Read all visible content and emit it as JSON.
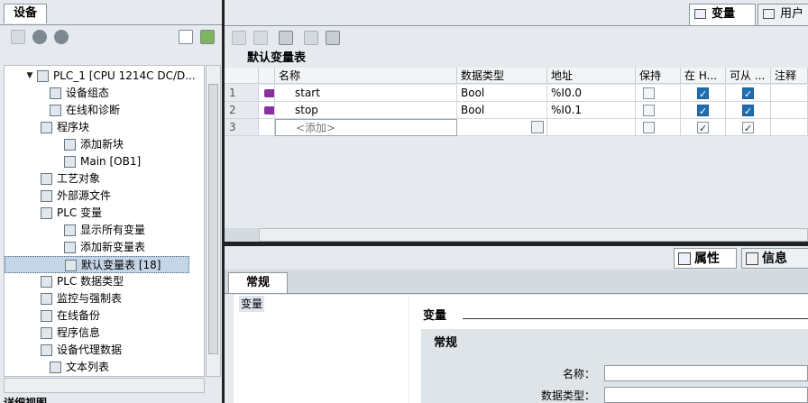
{
  "left_panel": {
    "tab": "设备",
    "tree": [
      {
        "label": "PLC_1 [CPU 1214C DC/D...",
        "expand": "▼",
        "icon": "plc-icon"
      },
      {
        "label": "设备组态",
        "expand": "",
        "icon": "device-config-icon"
      },
      {
        "label": "在线和诊断",
        "expand": "",
        "icon": "online-diagnostics-icon"
      },
      {
        "label": "程序块",
        "expand": "▼",
        "icon": "folder-icon"
      },
      {
        "label": "添加新块",
        "expand": "",
        "icon": "add-block-icon"
      },
      {
        "label": "Main [OB1]",
        "expand": "",
        "icon": "ob-block-icon"
      },
      {
        "label": "工艺对象",
        "expand": "▶",
        "icon": "folder-icon"
      },
      {
        "label": "外部源文件",
        "expand": "▶",
        "icon": "folder-icon"
      },
      {
        "label": "PLC 变量",
        "expand": "▼",
        "icon": "folder-icon"
      },
      {
        "label": "显示所有变量",
        "expand": "",
        "icon": "show-tags-icon"
      },
      {
        "label": "添加新变量表",
        "expand": "",
        "icon": "add-tag-table-icon"
      },
      {
        "label": "默认变量表 [18]",
        "expand": "",
        "icon": "tag-table-icon",
        "selected": true
      },
      {
        "label": "PLC 数据类型",
        "expand": "▶",
        "icon": "folder-icon"
      },
      {
        "label": "监控与强制表",
        "expand": "▶",
        "icon": "folder-icon"
      },
      {
        "label": "在线备份",
        "expand": "▶",
        "icon": "folder-icon"
      },
      {
        "label": "程序信息",
        "expand": "",
        "icon": "program-info-icon"
      },
      {
        "label": "设备代理数据",
        "expand": "▶",
        "icon": "folder-icon"
      },
      {
        "label": "文本列表",
        "expand": "",
        "icon": "text-list-icon"
      }
    ],
    "detail_view": "详细视图"
  },
  "right_tabs": {
    "tags": "变量",
    "user_constants": "用户常"
  },
  "table": {
    "title": "默认变量表",
    "headers": [
      "名称",
      "数据类型",
      "地址",
      "保持",
      "在 H...",
      "可从 ...",
      "注释"
    ],
    "rows": [
      {
        "num": "1",
        "name": "start",
        "type": "Bool",
        "addr": "%I0.0",
        "retain": false,
        "hmi": true,
        "access": true
      },
      {
        "num": "2",
        "name": "stop",
        "type": "Bool",
        "addr": "%I0.1",
        "retain": false,
        "hmi": true,
        "access": true
      },
      {
        "num": "3",
        "name": "<添加>",
        "type": "",
        "addr": "",
        "retain": false,
        "hmi": true,
        "access": true
      }
    ]
  },
  "inspector": {
    "tab_properties": "属性",
    "tab_info": "信息",
    "general_tab": "常规",
    "nav_item": "变量",
    "section_title": "变量",
    "sub_title": "常规",
    "field_name_label": "名称：",
    "field_type_label": "数据类型："
  }
}
